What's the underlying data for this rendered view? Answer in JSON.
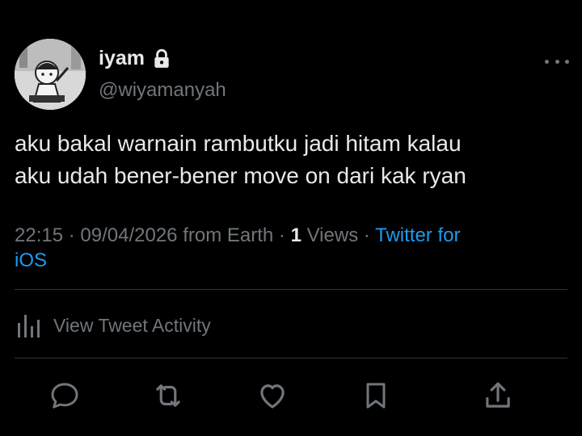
{
  "user": {
    "name": "iyam",
    "handle": "@wiyamanyah",
    "avatar_icon": "avatar-image",
    "badge_icon": "lock-icon"
  },
  "tweet": {
    "text_line1": "aku bakal warnain rambutku jadi hitam kalau",
    "text_line2": "aku udah bener-bener move on dari kak ryan"
  },
  "meta": {
    "time": "22:15",
    "date": "09/04/2026",
    "location": "from Earth",
    "separator": "·",
    "views_count": "1",
    "views_label": "Views",
    "source_part1": "Twitter for",
    "source_part2": "iOS"
  },
  "activity": {
    "label": "View Tweet Activity",
    "icon": "bar-chart-icon"
  },
  "actions": [
    {
      "name": "reply",
      "icon": "reply-icon"
    },
    {
      "name": "retweet",
      "icon": "retweet-icon"
    },
    {
      "name": "like",
      "icon": "heart-icon"
    },
    {
      "name": "bookmark",
      "icon": "bookmark-icon"
    },
    {
      "name": "share",
      "icon": "share-icon"
    }
  ],
  "colors": {
    "background": "#000000",
    "primary_text": "#e7e9ea",
    "secondary_text": "#71767b",
    "link": "#1d9bf0",
    "divider": "#2f3336"
  }
}
